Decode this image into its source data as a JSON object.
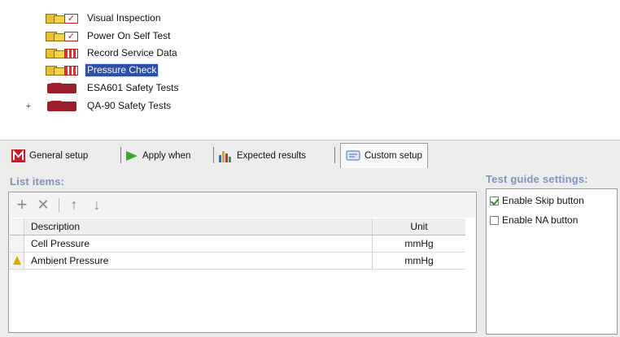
{
  "tree": {
    "items": [
      {
        "label": "Visual Inspection",
        "icon": "checklist-icon"
      },
      {
        "label": "Power On Self Test",
        "icon": "checklist-icon"
      },
      {
        "label": "Record Service Data",
        "icon": "data-form-icon"
      },
      {
        "label": "Pressure Check",
        "icon": "data-form-icon",
        "selected": true
      },
      {
        "label": "ESA601 Safety Tests",
        "icon": "folder-icon"
      },
      {
        "label": "QA-90 Safety Tests",
        "icon": "folder-icon",
        "collapsed": true
      }
    ]
  },
  "tabs": [
    {
      "label": "General setup",
      "icon": "general-setup-icon"
    },
    {
      "label": "Apply when",
      "icon": "apply-when-icon"
    },
    {
      "label": "Expected results",
      "icon": "expected-results-icon"
    },
    {
      "label": "Custom setup",
      "icon": "custom-setup-icon",
      "active": true
    }
  ],
  "list_items": {
    "title": "List items:",
    "toolbar": {
      "add": "+",
      "delete": "✕",
      "move_up": "↑",
      "move_down": "↓"
    },
    "columns": [
      "Description",
      "Unit"
    ],
    "rows": [
      {
        "description": "Cell Pressure",
        "unit": "mmHg"
      },
      {
        "description": "Ambient Pressure",
        "unit": "mmHg"
      }
    ]
  },
  "test_guide": {
    "title": "Test guide settings:",
    "options": [
      {
        "label": "Enable Skip button",
        "checked": true
      },
      {
        "label": "Enable NA button",
        "checked": false
      }
    ]
  },
  "colors": {
    "selection": "#2b4fa8",
    "section_title": "#7e93bc"
  }
}
